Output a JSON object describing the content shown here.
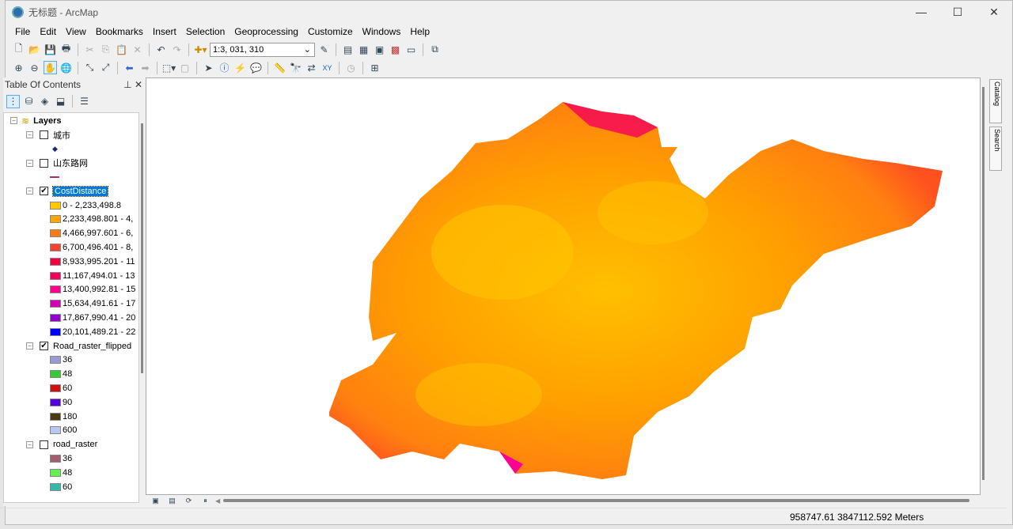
{
  "window": {
    "title": "无标题 - ArcMap",
    "controls": [
      "—",
      "☐",
      "✕"
    ]
  },
  "menu": [
    "File",
    "Edit",
    "View",
    "Bookmarks",
    "Insert",
    "Selection",
    "Geoprocessing",
    "Customize",
    "Windows",
    "Help"
  ],
  "toolbar": {
    "scale": "1:3, 031, 310"
  },
  "toc": {
    "title": "Table Of Contents",
    "root": "Layers",
    "layers": [
      {
        "name": "城市",
        "checked": false,
        "legend": [
          {
            "label": "",
            "color": "#1a2a6a",
            "kind": "point"
          }
        ]
      },
      {
        "name": "山东路网",
        "checked": false,
        "legend": [
          {
            "label": "",
            "color": "#b0305a",
            "kind": "line"
          }
        ]
      },
      {
        "name": "CostDistance",
        "checked": true,
        "selected": true,
        "legend": [
          {
            "label": "0 - 2,233,498.8",
            "color": "#FFC800"
          },
          {
            "label": "2,233,498.801 - 4,",
            "color": "#FFA500"
          },
          {
            "label": "4,466,997.601 - 6,",
            "color": "#FF7A10"
          },
          {
            "label": "6,700,496.401 - 8,",
            "color": "#FF4030"
          },
          {
            "label": "8,933,995.201 - 11",
            "color": "#F50040"
          },
          {
            "label": "11,167,494.01 - 13",
            "color": "#F5005A"
          },
          {
            "label": "13,400,992.81 - 15",
            "color": "#FF0090"
          },
          {
            "label": "15,634,491.61 - 17",
            "color": "#D000B0"
          },
          {
            "label": "17,867,990.41 - 20",
            "color": "#9000D0"
          },
          {
            "label": "20,101,489.21 - 22",
            "color": "#0000FF"
          }
        ]
      },
      {
        "name": "Road_raster_flipped",
        "checked": true,
        "legend": [
          {
            "label": "36",
            "color": "#9A9AD0"
          },
          {
            "label": "48",
            "color": "#33CC33"
          },
          {
            "label": "60",
            "color": "#D01010"
          },
          {
            "label": "90",
            "color": "#5500DD"
          },
          {
            "label": "180",
            "color": "#4A3A10"
          },
          {
            "label": "600",
            "color": "#B8C8F0"
          }
        ]
      },
      {
        "name": "road_raster",
        "checked": false,
        "legend": [
          {
            "label": "36",
            "color": "#A06070"
          },
          {
            "label": "48",
            "color": "#66EE55"
          },
          {
            "label": "60",
            "color": "#33BBAA"
          }
        ]
      }
    ]
  },
  "side_tabs": [
    "Catalog",
    "Search"
  ],
  "status": {
    "coords": "958747.61  3847112.592 Meters"
  }
}
